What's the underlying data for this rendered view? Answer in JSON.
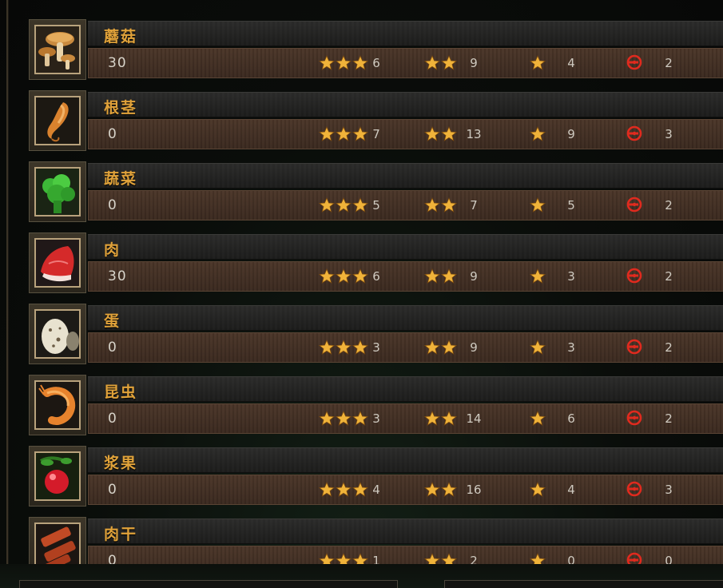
{
  "colors": {
    "name": "#e0a23a",
    "star": "#f0b33a",
    "token": "#e02a1e"
  },
  "rows": [
    {
      "name": "蘑菇",
      "count": "30",
      "icon": "mushroom-icon",
      "three_star": "6",
      "two_star": "9",
      "one_star": "4",
      "red": "2"
    },
    {
      "name": "根茎",
      "count": "0",
      "icon": "root-icon",
      "three_star": "7",
      "two_star": "13",
      "one_star": "9",
      "red": "3"
    },
    {
      "name": "蔬菜",
      "count": "0",
      "icon": "vegetable-icon",
      "three_star": "5",
      "two_star": "7",
      "one_star": "5",
      "red": "2"
    },
    {
      "name": "肉",
      "count": "30",
      "icon": "meat-icon",
      "three_star": "6",
      "two_star": "9",
      "one_star": "3",
      "red": "2"
    },
    {
      "name": "蛋",
      "count": "0",
      "icon": "egg-icon",
      "three_star": "3",
      "two_star": "9",
      "one_star": "3",
      "red": "2"
    },
    {
      "name": "昆虫",
      "count": "0",
      "icon": "insect-icon",
      "three_star": "3",
      "two_star": "14",
      "one_star": "6",
      "red": "2"
    },
    {
      "name": "浆果",
      "count": "0",
      "icon": "berry-icon",
      "three_star": "4",
      "two_star": "16",
      "one_star": "4",
      "red": "3"
    },
    {
      "name": "肉干",
      "count": "0",
      "icon": "jerky-icon",
      "three_star": "1",
      "two_star": "2",
      "one_star": "0",
      "red": "0"
    }
  ]
}
